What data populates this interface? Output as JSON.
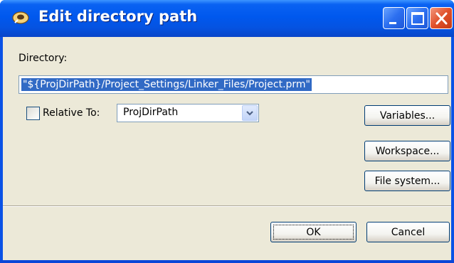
{
  "window": {
    "title": "Edit directory path",
    "title_icon": "eclipse-wrench-icon",
    "controls": [
      "minimize-icon",
      "maximize-icon",
      "close-icon"
    ]
  },
  "form": {
    "directory_label": "Directory:",
    "directory_value": "\"${ProjDirPath}/Project_Settings/Linker_Files/Project.prm\"",
    "relative_to_label": "Relative To:",
    "relative_to_checked": false,
    "relative_to_selected": "ProjDirPath"
  },
  "buttons": {
    "variables": "Variables...",
    "workspace": "Workspace...",
    "file_system": "File system...",
    "ok": "OK",
    "cancel": "Cancel"
  },
  "colors": {
    "titlebar": "#0058ee",
    "dialog_bg": "#ece9d8",
    "selection": "#316ac5",
    "close_button": "#e0512b"
  }
}
